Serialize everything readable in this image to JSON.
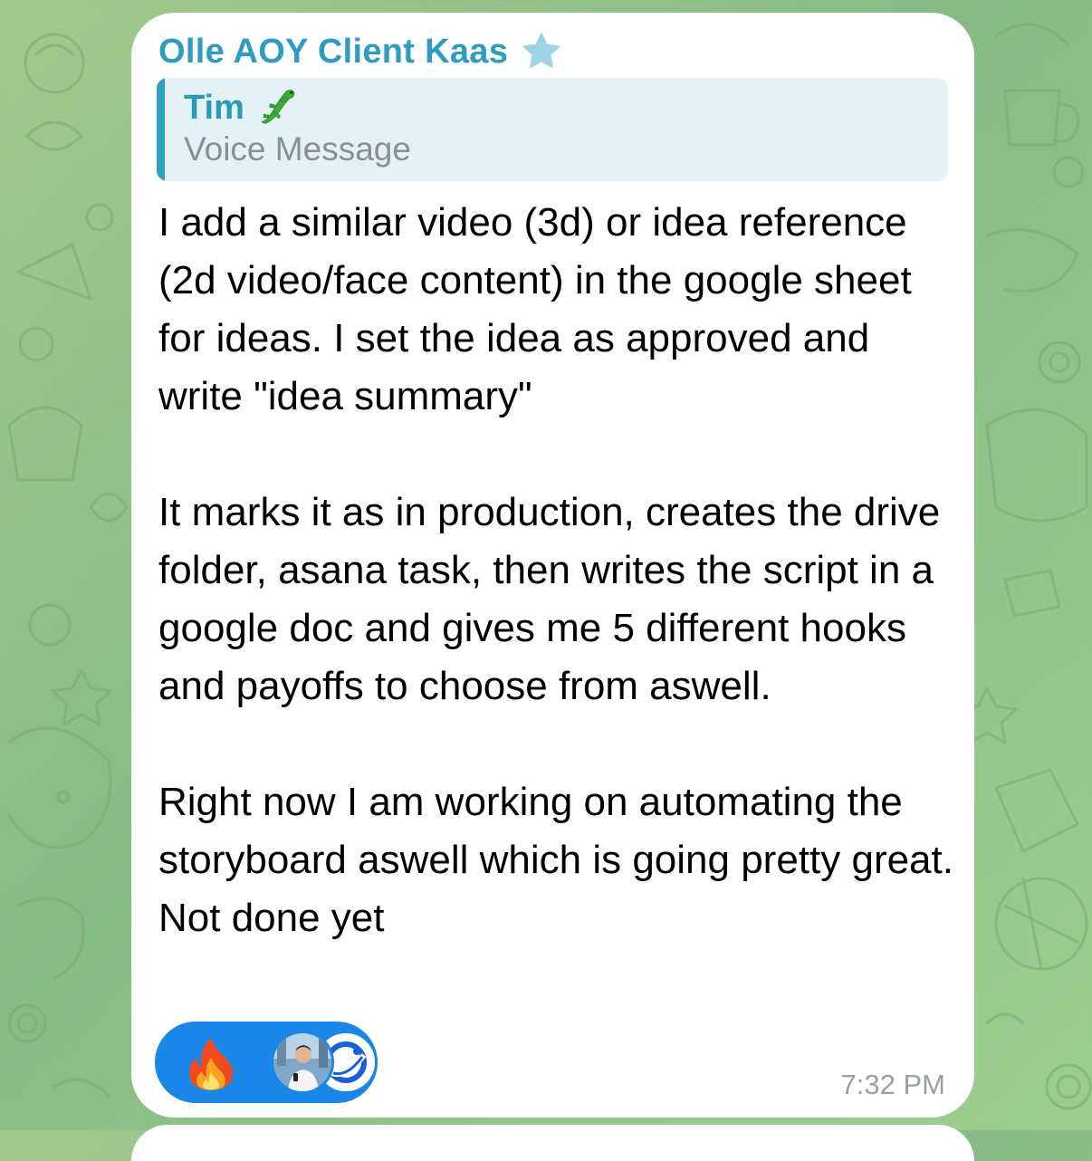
{
  "chat": {
    "sender_name": "Olle AOY Client Kaas",
    "sender_badge_icon": "star-icon",
    "reply": {
      "author": "Tim",
      "author_emoji_icon": "lizard-icon",
      "text": "Voice Message"
    },
    "message": {
      "paragraph_1": "I add a similar video (3d) or idea reference (2d video/face content) in the google sheet for ideas. I set the idea as approved and write \"idea summary\"",
      "paragraph_2": "It marks it as in production, creates the drive folder, asana task, then writes the script in a google doc and gives me 5 different hooks and payoffs to choose from aswell.",
      "paragraph_3": "Right now I am working on automating the storyboard aswell which is going pretty great. Not done yet"
    },
    "reactions": {
      "emoji_icon": "fire-icon",
      "avatars": [
        "user-avatar-photo",
        "user-avatar-logo"
      ]
    },
    "timestamp": "7:32 PM"
  },
  "colors": {
    "sender_name": "#2e9cc0",
    "reply_background": "#e4f2f5",
    "reply_bar": "#2fa0bf",
    "reaction_pill": "#1a86e8",
    "timestamp": "#9aa0a4",
    "wallpaper": "#93c289"
  }
}
